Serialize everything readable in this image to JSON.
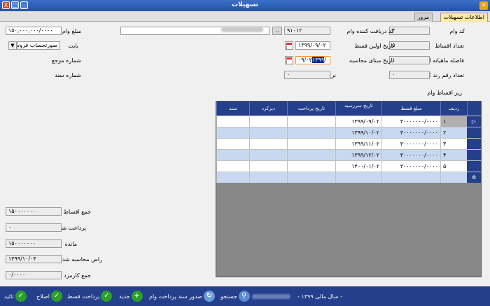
{
  "window": {
    "title": "تسهیلات",
    "buttons": [
      "X",
      "□",
      "_"
    ]
  },
  "tabs": [
    {
      "label": "اطلاعات تسهیلات"
    },
    {
      "label": "مرور"
    }
  ],
  "form": {
    "loan_code_label": "کد وام",
    "loan_code": "۲",
    "receiver_code_label": "کد دریافت کننده وام",
    "receiver_code": "۹۱۰۱۲",
    "browse_btn": "..",
    "loan_amount_label": "مبلغ وام",
    "loan_amount": "۱۵۰,۰۰۰,۰۰۰/۰۰۰۰",
    "inst_count_label": "تعداد اقساط",
    "inst_count": "۵",
    "first_date_label": "تاریخ اولین قسط",
    "first_date": "۱۳۹۹/۰۹/۰۲",
    "section_label": "بابت",
    "section_value": "صورتحساب فروش",
    "interval_label": "فاصله ماهیانه اقساط",
    "interval": "۱",
    "base_date_label": "تاریخ مبنای محاسبه",
    "base_date_sel": "۱۳۹۹",
    "base_date_rest": "/۰۹/۰۲",
    "ref_label": "شماره مرجع",
    "ref_value": "۰",
    "round_label": "تعداد رقم رند کردن",
    "round_value": "۰",
    "profit_label": "نرخ سود",
    "profit_value": "۰",
    "doc_label": "شماره سند",
    "doc_value": "۰",
    "grid_title": "ریز اقساط وام"
  },
  "grid": {
    "columns": [
      "ردیف",
      "مبلغ قسط",
      "تاریخ سررسید",
      "تاریخ پرداخت",
      "دیرکرد",
      "سند"
    ],
    "rows": [
      {
        "n": "۱",
        "amount": "۳۰۰۰۰۰۰۰/۰۰۰۰",
        "due": "۱۳۹۹/۰۹/۰۲",
        "pay": "",
        "late": "",
        "doc": ""
      },
      {
        "n": "۲",
        "amount": "۳۰۰۰۰۰۰۰/۰۰۰۰",
        "due": "۱۳۹۹/۱۰/۰۲",
        "pay": "",
        "late": "",
        "doc": ""
      },
      {
        "n": "۳",
        "amount": "۳۰۰۰۰۰۰۰/۰۰۰۰",
        "due": "۱۳۹۹/۱۱/۰۲",
        "pay": "",
        "late": "",
        "doc": ""
      },
      {
        "n": "۴",
        "amount": "۳۰۰۰۰۰۰۰/۰۰۰۰",
        "due": "۱۳۹۹/۱۲/۰۲",
        "pay": "",
        "late": "",
        "doc": ""
      },
      {
        "n": "۵",
        "amount": "۳۰۰۰۰۰۰۰/۰۰۰۰",
        "due": "۱۴۰۰/۰۱/۰۲",
        "pay": "",
        "late": "",
        "doc": ""
      }
    ]
  },
  "totals": {
    "sum_label": "جمع اقساط",
    "sum": "۱۵۰۰۰۰۰۰۰",
    "paid_label": "پرداخت شده",
    "paid": "۰",
    "remain_label": "مانده",
    "remain": "۱۵۰۰۰۰۰۰۰",
    "due_label": "راس محاسبه شده",
    "due": "۱۳۹۹/۱۰/۰۴",
    "fee_label": "جمع کارمزد",
    "fee": "۰/۰۰۰۰"
  },
  "footer": {
    "fiscal_year": "- سال مالی ۱۳۹۹ -",
    "search": "جستجو",
    "issue_doc": "صدور سند پرداخت وام",
    "new": "جدید",
    "pay_inst": "پرداخت قسط",
    "fix": "اصلاح",
    "confirm": "تائید"
  }
}
